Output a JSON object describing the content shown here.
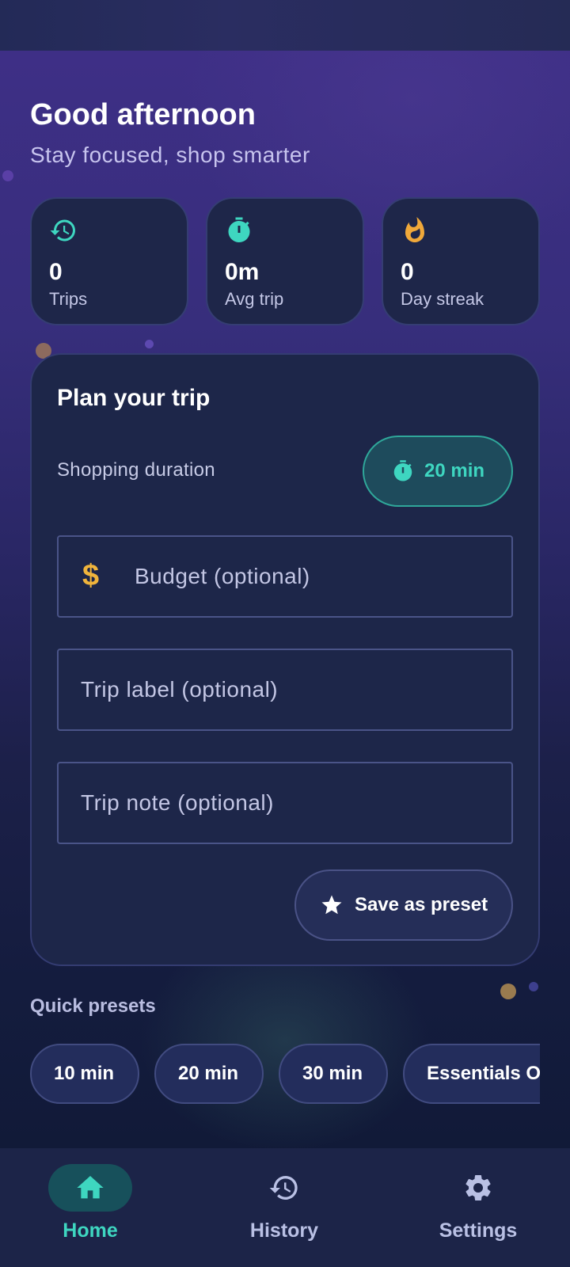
{
  "header": {
    "greeting": "Good afternoon",
    "subtitle": "Stay focused, shop smarter"
  },
  "stats": [
    {
      "icon": "history-icon",
      "value": "0",
      "label": "Trips",
      "color": "#3ed6c0"
    },
    {
      "icon": "timer-icon",
      "value": "0m",
      "label": "Avg trip",
      "color": "#3ed6c0"
    },
    {
      "icon": "flame-icon",
      "value": "0",
      "label": "Day streak",
      "color": "#f0a83a"
    }
  ],
  "plan": {
    "title": "Plan your trip",
    "duration_label": "Shopping duration",
    "duration_value": "20 min",
    "budget_placeholder": "Budget (optional)",
    "label_placeholder": "Trip label (optional)",
    "note_placeholder": "Trip note (optional)",
    "save_preset_label": "Save as preset"
  },
  "quick_presets": {
    "title": "Quick presets",
    "items": [
      "10 min",
      "20 min",
      "30 min",
      "Essentials Only"
    ]
  },
  "nav": {
    "items": [
      {
        "label": "Home",
        "icon": "home-icon",
        "active": true
      },
      {
        "label": "History",
        "icon": "history-icon",
        "active": false
      },
      {
        "label": "Settings",
        "icon": "gear-icon",
        "active": false
      }
    ]
  },
  "colors": {
    "accent": "#3ed6c0",
    "warm": "#f0b43c",
    "card": "#1d2649",
    "nav_inactive": "#b9c0e4"
  }
}
